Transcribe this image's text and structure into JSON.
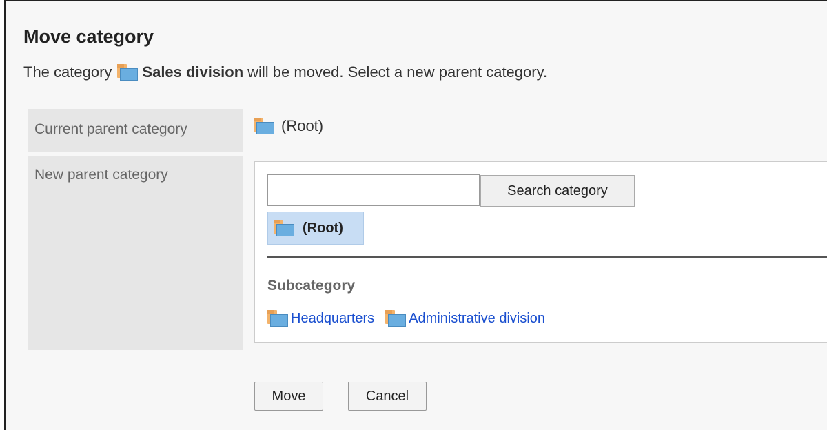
{
  "dialog": {
    "title": "Move category",
    "description_prefix": "The category",
    "category_name": "Sales division",
    "description_suffix": "will be moved. Select a new parent category."
  },
  "current_parent": {
    "label": "Current parent category",
    "value": "(Root)"
  },
  "new_parent": {
    "label": "New parent category",
    "search_input": {
      "value": "",
      "placeholder": ""
    },
    "search_button": "Search category",
    "selected": "(Root)",
    "subcategory_heading": "Subcategory",
    "subcategories": [
      "Headquarters",
      "Administrative division"
    ]
  },
  "actions": {
    "move": "Move",
    "cancel": "Cancel"
  },
  "colors": {
    "link": "#1a4fcf",
    "selected_bg": "#c8ddf4",
    "label_bg": "#e6e6e6",
    "folder_front": "#6aaee0",
    "folder_back": "#f3b36b"
  }
}
